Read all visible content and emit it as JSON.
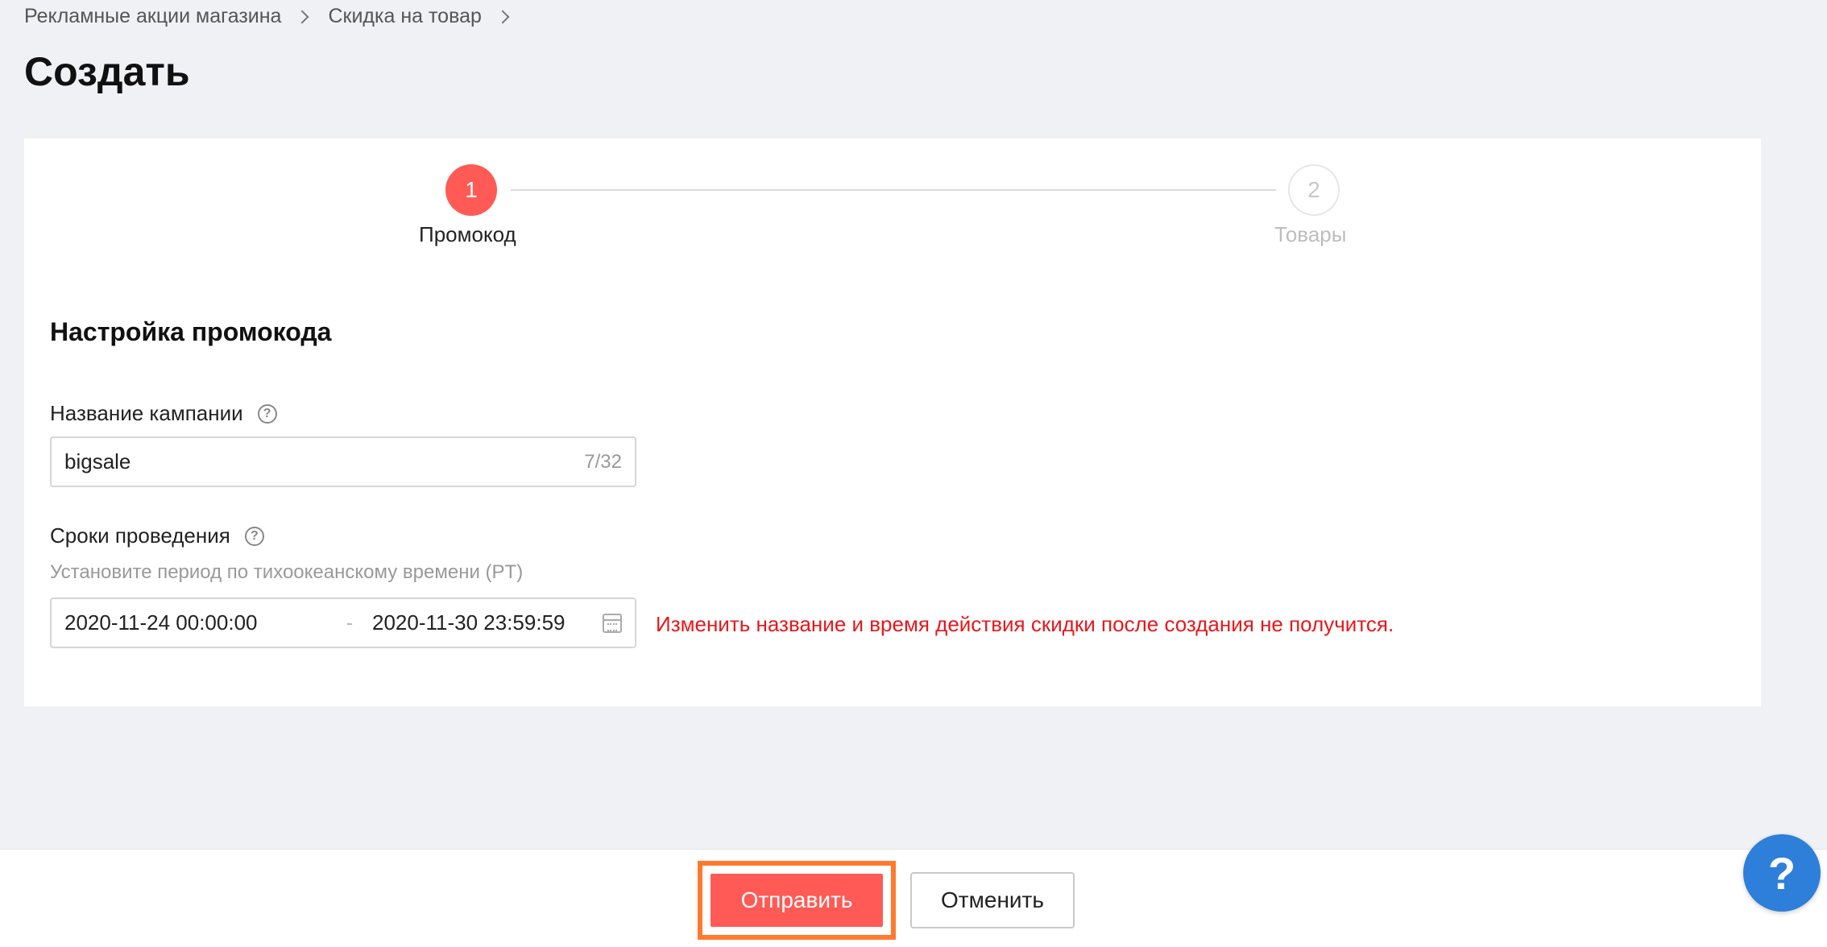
{
  "breadcrumb": {
    "items": [
      "Рекламные акции магазина",
      "Скидка на товар"
    ]
  },
  "page": {
    "title": "Создать"
  },
  "steps": [
    {
      "number": "1",
      "label": "Промокод",
      "active": true
    },
    {
      "number": "2",
      "label": "Товары",
      "active": false
    }
  ],
  "form": {
    "section_title": "Настройка промокода",
    "campaign_name": {
      "label": "Название кампании",
      "value": "bigsale",
      "counter": "7/32"
    },
    "period": {
      "label": "Сроки проведения",
      "hint": "Установите период по тихоокеанскому времени (PT)",
      "start": "2020-11-24 00:00:00",
      "separator": "-",
      "end": "2020-11-30 23:59:59",
      "warning": "Изменить название и время действия скидки после создания не получится."
    }
  },
  "footer": {
    "submit_label": "Отправить",
    "cancel_label": "Отменить"
  },
  "help_fab": {
    "label": "?"
  },
  "colors": {
    "accent": "#ff5a55",
    "highlight_frame": "#ff7a2e",
    "warning": "#e8171b",
    "fab": "#2d7fd9"
  }
}
